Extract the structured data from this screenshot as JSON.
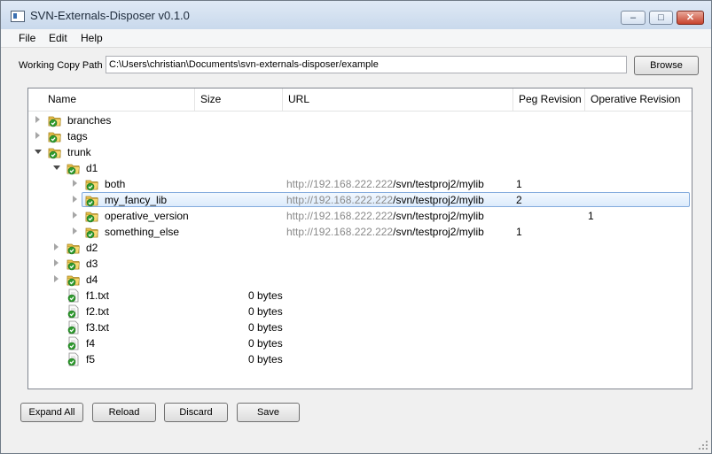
{
  "window": {
    "title": "SVN-Externals-Disposer v0.1.0",
    "min_glyph": "–",
    "max_glyph": "□",
    "close_glyph": "✕"
  },
  "menu": [
    "File",
    "Edit",
    "Help"
  ],
  "working_copy": {
    "label": "Working Copy Path",
    "value": "C:\\Users\\christian\\Documents\\svn-externals-disposer/example",
    "browse_label": "Browse"
  },
  "columns": [
    "Name",
    "Size",
    "URL",
    "Peg Revision",
    "Operative Revision"
  ],
  "url_host": "http://192.168.222.222",
  "url_path": "/svn/testproj2/mylib",
  "rows": [
    {
      "name": "branches",
      "level": 0,
      "arrow": "collapsed",
      "icon": "folder-versioned-icon",
      "size": "",
      "url": false,
      "peg": "",
      "op": ""
    },
    {
      "name": "tags",
      "level": 0,
      "arrow": "collapsed",
      "icon": "folder-versioned-icon",
      "size": "",
      "url": false,
      "peg": "",
      "op": ""
    },
    {
      "name": "trunk",
      "level": 0,
      "arrow": "expanded",
      "icon": "folder-versioned-icon",
      "size": "",
      "url": false,
      "peg": "",
      "op": ""
    },
    {
      "name": "d1",
      "level": 1,
      "arrow": "expanded",
      "icon": "folder-versioned-icon",
      "size": "",
      "url": false,
      "peg": "",
      "op": ""
    },
    {
      "name": "both",
      "level": 2,
      "arrow": "collapsed",
      "icon": "folder-versioned-icon",
      "size": "",
      "url": true,
      "peg": "1",
      "op": ""
    },
    {
      "name": "my_fancy_lib",
      "level": 2,
      "arrow": "collapsed",
      "icon": "folder-versioned-icon",
      "size": "",
      "url": true,
      "peg": "2",
      "op": "",
      "selected": true
    },
    {
      "name": "operative_version",
      "level": 2,
      "arrow": "collapsed",
      "icon": "folder-versioned-icon",
      "size": "",
      "url": true,
      "peg": "",
      "op": "1"
    },
    {
      "name": "something_else",
      "level": 2,
      "arrow": "collapsed",
      "icon": "folder-versioned-icon",
      "size": "",
      "url": true,
      "peg": "1",
      "op": ""
    },
    {
      "name": "d2",
      "level": 1,
      "arrow": "collapsed",
      "icon": "folder-versioned-icon",
      "size": "",
      "url": false,
      "peg": "",
      "op": ""
    },
    {
      "name": "d3",
      "level": 1,
      "arrow": "collapsed",
      "icon": "folder-versioned-icon",
      "size": "",
      "url": false,
      "peg": "",
      "op": ""
    },
    {
      "name": "d4",
      "level": 1,
      "arrow": "collapsed",
      "icon": "folder-versioned-icon",
      "size": "",
      "url": false,
      "peg": "",
      "op": ""
    },
    {
      "name": "f1.txt",
      "level": 1,
      "arrow": "none",
      "icon": "file-versioned-icon",
      "size": "0 bytes",
      "url": false,
      "peg": "",
      "op": ""
    },
    {
      "name": "f2.txt",
      "level": 1,
      "arrow": "none",
      "icon": "file-versioned-icon",
      "size": "0 bytes",
      "url": false,
      "peg": "",
      "op": ""
    },
    {
      "name": "f3.txt",
      "level": 1,
      "arrow": "none",
      "icon": "file-versioned-icon",
      "size": "0 bytes",
      "url": false,
      "peg": "",
      "op": ""
    },
    {
      "name": "f4",
      "level": 1,
      "arrow": "none",
      "icon": "file-versioned-icon",
      "size": "0 bytes",
      "url": false,
      "peg": "",
      "op": ""
    },
    {
      "name": "f5",
      "level": 1,
      "arrow": "none",
      "icon": "file-versioned-icon",
      "size": "0 bytes",
      "url": false,
      "peg": "",
      "op": ""
    }
  ],
  "buttons": {
    "expand_all": "Expand All",
    "reload": "Reload",
    "discard": "Discard",
    "save": "Save"
  },
  "colors": {
    "selection_border": "#84acdd",
    "check_green": "#2e9b2e",
    "folder_yellow": "#e8c14a"
  }
}
